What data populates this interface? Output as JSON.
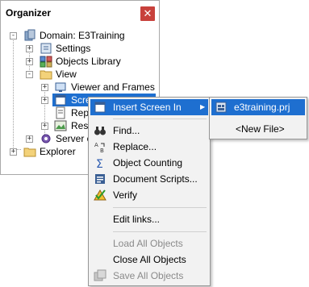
{
  "organizer": {
    "title": "Organizer",
    "close_glyph": "✕",
    "tree": {
      "domain": "Domain: E3Training",
      "settings": "Settings",
      "objects_library": "Objects Library",
      "view": "View",
      "viewer_frames": "Viewer and Frames",
      "screens": "Screens",
      "reports": "Repo",
      "resources": "Reso",
      "server_objects": "Server ob",
      "explorer": "Explorer"
    }
  },
  "context_menu": {
    "insert_screen_in": "Insert Screen In",
    "find": "Find...",
    "replace": "Replace...",
    "object_counting": "Object Counting",
    "document_scripts": "Document Scripts...",
    "verify": "Verify",
    "edit_links": "Edit links...",
    "load_all": "Load All Objects",
    "close_all": "Close All Objects",
    "save_all": "Save All Objects",
    "submenu_arrow": "▶"
  },
  "submenu": {
    "project": "e3training.prj",
    "new_file": "<New File>"
  },
  "colors": {
    "selection": "#1e6fd0",
    "close_button": "#c8413c"
  }
}
